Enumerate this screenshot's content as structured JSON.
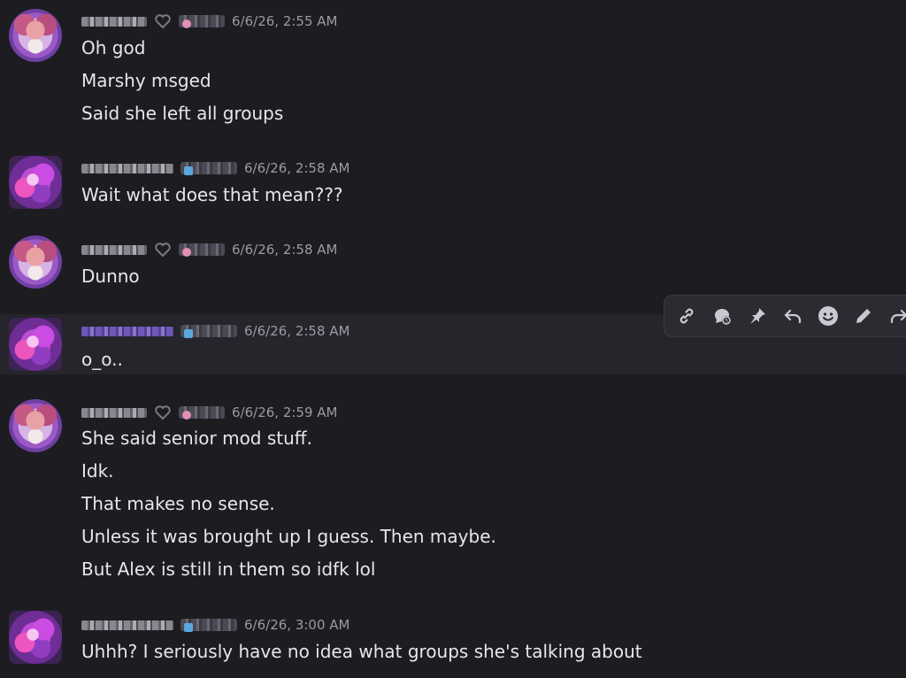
{
  "messages": [
    {
      "timestamp": "6/6/26, 2:55 AM",
      "lines": [
        "Oh god",
        "Marshy msged",
        "Said she left all groups"
      ]
    },
    {
      "timestamp": "6/6/26, 2:58 AM",
      "lines": [
        "Wait what does that mean???"
      ]
    },
    {
      "timestamp": "6/6/26, 2:58 AM",
      "lines": [
        "Dunno"
      ]
    },
    {
      "timestamp": "6/6/26, 2:58 AM",
      "lines": [
        "o_o.."
      ]
    },
    {
      "timestamp": "6/6/26, 2:59 AM",
      "lines": [
        "She said senior mod stuff.",
        "Idk.",
        "That makes no sense.",
        "Unless it was brought up I guess. Then maybe.",
        "But Alex is still in them so idfk lol"
      ]
    },
    {
      "timestamp": "6/6/26, 3:00 AM",
      "lines": [
        "Uhhh? I seriously have no idea what groups she's talking about"
      ]
    }
  ],
  "toolbar": {
    "icons": [
      "link-icon",
      "thread-icon",
      "pin-icon",
      "reply-icon",
      "emoji-icon",
      "edit-icon",
      "forward-icon"
    ]
  },
  "colors": {
    "background": "#1c1c21",
    "hover_background": "#25252b",
    "text": "#e6e7ea",
    "timestamp": "#9a9ba3",
    "toolbar_bg": "#2b2b31"
  }
}
